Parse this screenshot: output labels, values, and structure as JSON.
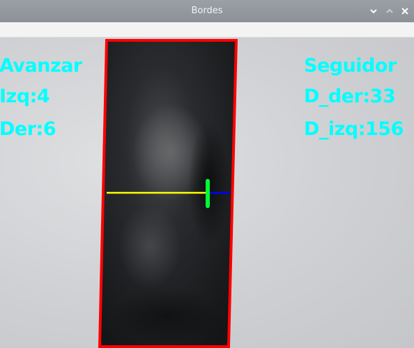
{
  "window": {
    "title": "Bordes"
  },
  "overlay": {
    "left_block": {
      "mode": "Avanzar",
      "izq": "Izq:4",
      "der": "Der:6"
    },
    "right_block": {
      "mode": "Seguidor",
      "d_der": "D_der:33",
      "d_izq": "D_izq:156"
    }
  },
  "colors": {
    "text": "#00ffff",
    "border": "#ff0000",
    "center_line": "#ffff00",
    "marker": "#00ff33",
    "right_segment": "#0000ff"
  },
  "icons": {
    "minimize": "chevron-down-icon",
    "maximize": "chevron-up-icon",
    "close": "close-icon"
  }
}
